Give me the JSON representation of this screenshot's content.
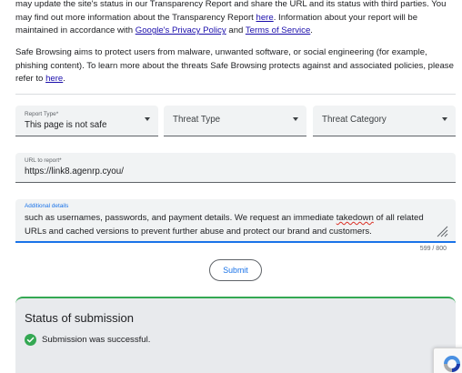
{
  "intro": {
    "p1_a": "may update the site's status in our Transparency Report and share the URL and its status with third parties. You may find out more information about the Transparency Report ",
    "p1_link_here": "here",
    "p1_b": ". Information about your report will be maintained in accordance with ",
    "p1_link_privacy": "Google's Privacy Policy",
    "p1_c": " and ",
    "p1_link_tos": "Terms of Service",
    "p1_d": ".",
    "p2_a": "Safe Browsing aims to protect users from malware, unwanted software, or social engineering (for example, phishing content). To learn more about the threats Safe Browsing protects against and associated policies, please refer to ",
    "p2_link_here": "here",
    "p2_b": "."
  },
  "form": {
    "report_type": {
      "label": "Report Type*",
      "value": "This page is not safe"
    },
    "threat_type": {
      "placeholder": "Threat Type"
    },
    "threat_category": {
      "placeholder": "Threat Category"
    },
    "url": {
      "label": "URL to report*",
      "value": "https://link8.agenrp.cyou/"
    },
    "details": {
      "label": "Additional details",
      "line1_a": "such as usernames, passwords, and payment details. We request an immediate ",
      "line1_misspelled": "takedown",
      "line1_b": " of all related",
      "line2": "URLs and cached versions to prevent further abuse and protect our brand and customers."
    },
    "counter": "599 / 800",
    "submit_label": "Submit"
  },
  "status": {
    "title": "Status of submission",
    "message": "Submission was successful."
  },
  "colors": {
    "link": "#1a0dab",
    "accent": "#1a73e8",
    "success": "#34a853",
    "field_bg": "#f1f3f4"
  },
  "icons": [
    "chevron-down-icon",
    "resize-handle-icon",
    "check-circle-icon",
    "recaptcha-icon"
  ]
}
